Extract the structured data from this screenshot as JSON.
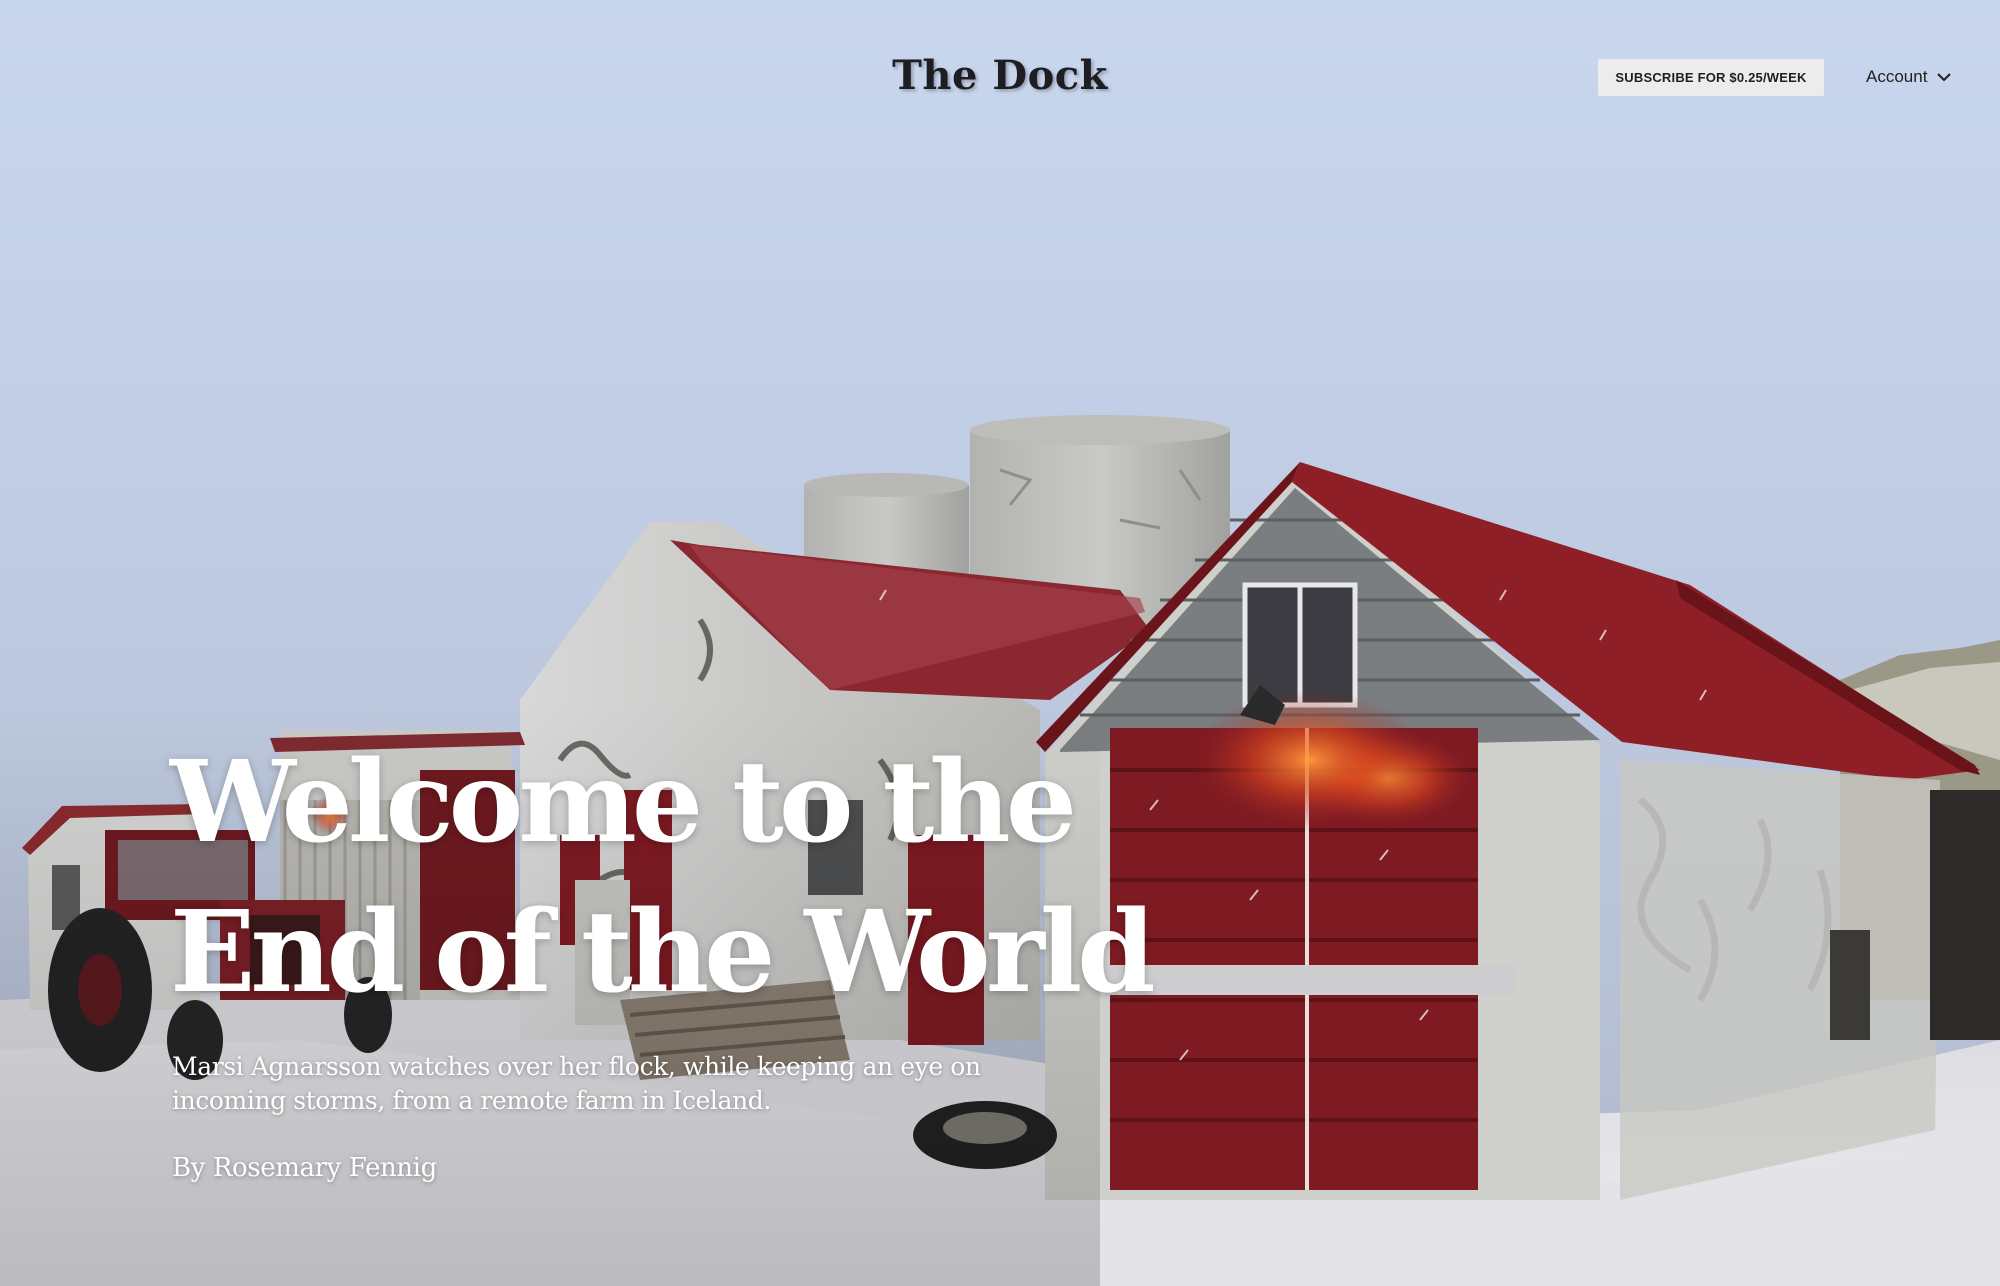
{
  "masthead": {
    "logo": "The Dock",
    "subscribe_label": "SUBSCRIBE FOR $0.25/WEEK",
    "account_label": "Account",
    "account_icon": "chevron-down-icon"
  },
  "article": {
    "headline_line1": "Welcome to the",
    "headline_line2": "End of the World",
    "dek": "Marsi Agnarsson watches over her flock, while keeping an eye on incoming storms, from a remote farm in Iceland.",
    "byline": "By Rosemary Fennig"
  },
  "colors": {
    "sky": "#c7d4ea",
    "roof_red": "#8e1f27",
    "door_red": "#7e1a22",
    "snow": "#e6e6ea",
    "text_white": "#ffffff",
    "button_bg": "#ececec"
  }
}
